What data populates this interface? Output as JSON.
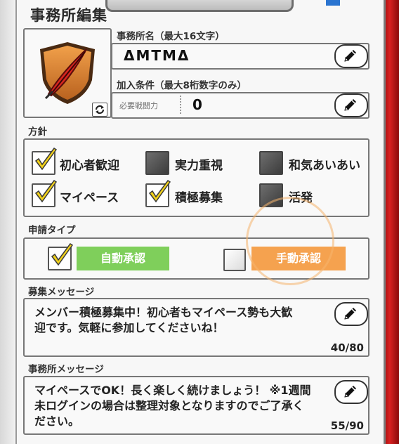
{
  "header": {
    "title": "事務所編集"
  },
  "office_name": {
    "label": "事務所名（最大16文字）",
    "value": "ΔMTMΔ"
  },
  "join_condition": {
    "label": "加入条件（最大8桁数字のみ）",
    "sub_label": "必要戦闘力",
    "value": "0"
  },
  "policy": {
    "label": "方針",
    "options": [
      {
        "label": "初心者歓迎",
        "checked": true
      },
      {
        "label": "実力重視",
        "checked": false
      },
      {
        "label": "和気あいあい",
        "checked": false
      },
      {
        "label": "マイペース",
        "checked": true
      },
      {
        "label": "積極募集",
        "checked": true
      },
      {
        "label": "活発",
        "checked": false
      }
    ]
  },
  "apply_type": {
    "label": "申請タイプ",
    "auto_label": "自動承認",
    "auto_checked": true,
    "manual_label": "手動承認",
    "manual_checked": false
  },
  "recruit_message": {
    "label": "募集メッセージ",
    "line1": "メンバー積極募集中！初心者もマイペース勢も大歓",
    "line2": "迎です。気軽に参加してくださいね！",
    "counter": "40/80"
  },
  "office_message": {
    "label": "事務所メッセージ",
    "line1": "マイペースでOK！長く楽しく続けましょう！ ※1週間",
    "line2": "未ログインの場合は整理対象となりますのでご了承く",
    "line3": "ださい。",
    "counter": "55/90"
  },
  "icons": [
    "feather-emblem-icon",
    "refresh-icon",
    "pencil-icon",
    "check-icon"
  ],
  "colors": {
    "auto_button": "#7fcf5b",
    "manual_button": "#f5a24f",
    "accent_red": "#c41818"
  }
}
